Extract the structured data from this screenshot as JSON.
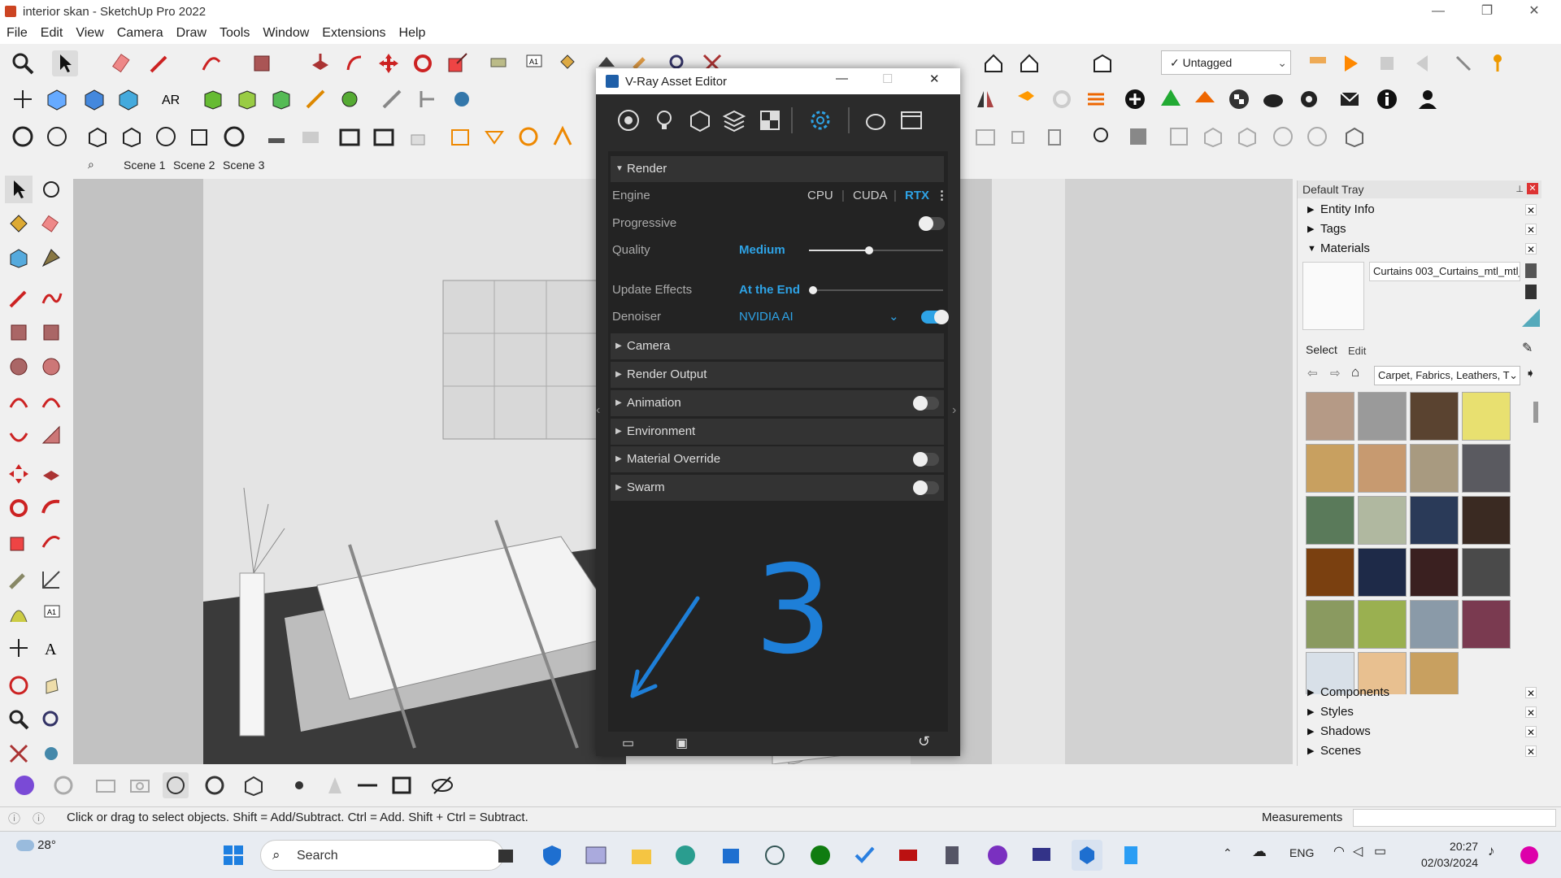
{
  "window": {
    "title": "interior skan - SketchUp Pro 2022"
  },
  "menu": [
    "File",
    "Edit",
    "View",
    "Camera",
    "Draw",
    "Tools",
    "Window",
    "Extensions",
    "Help"
  ],
  "tag_select": {
    "value": "Untagged"
  },
  "scenes": [
    "Scene 1",
    "Scene 2",
    "Scene 3"
  ],
  "vray": {
    "title": "V-Ray Asset Editor",
    "render_section": "Render",
    "engine_label": "Engine",
    "engines": [
      "CPU",
      "CUDA",
      "RTX"
    ],
    "progressive_label": "Progressive",
    "quality_label": "Quality",
    "quality_value": "Medium",
    "quality_level": 0.45,
    "update_effects_label": "Update Effects",
    "update_effects_value": "At the End",
    "denoiser_label": "Denoiser",
    "denoiser_value": "NVIDIA AI",
    "sections": [
      "Camera",
      "Render Output",
      "Animation",
      "Environment",
      "Material Override",
      "Swarm"
    ],
    "annotation": "3"
  },
  "tray": {
    "title": "Default Tray",
    "panels": [
      "Entity Info",
      "Tags",
      "Materials"
    ],
    "material_name": "Curtains 003_Curtains_mtl_mtl_",
    "tabs": [
      "Select",
      "Edit"
    ],
    "library": "Carpet, Fabrics, Leathers, T",
    "bottom_panels": [
      "Components",
      "Styles",
      "Shadows",
      "Scenes"
    ],
    "swatch_colors": [
      "#b59a86",
      "#9a9a9a",
      "#5a4330",
      "#e8e070",
      "#c8a060",
      "#c79a70",
      "#a89a80",
      "#5a5a60",
      "#5a7a5a",
      "#b0b8a0",
      "#2a3a58",
      "#3a2a22",
      "#7a4010",
      "#1e2a48",
      "#3a2020",
      "#4a4a4a",
      "#8a9a60",
      "#9ab050",
      "#8a9aa8",
      "#7a3a50",
      "#d8e0e8",
      "#e8c090",
      "#c8a060"
    ]
  },
  "status": {
    "hint": "Click or drag to select objects. Shift = Add/Subtract. Ctrl = Add. Shift + Ctrl = Subtract.",
    "measurements": "Measurements"
  },
  "taskbar": {
    "weather": "28°",
    "search": "Search",
    "lang": "ENG",
    "time": "20:27",
    "date": "02/03/2024"
  }
}
